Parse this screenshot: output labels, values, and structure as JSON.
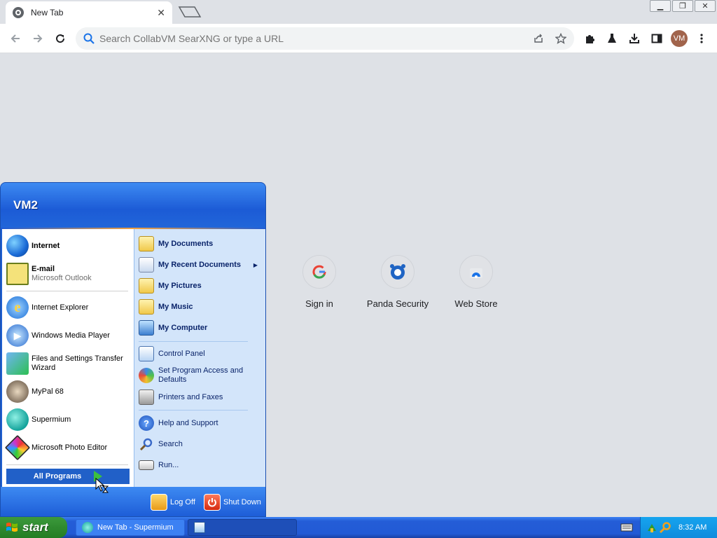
{
  "browser": {
    "tab_title": "New Tab",
    "tab_close": "✕",
    "window_controls": [
      "▁",
      "❐",
      "✕"
    ],
    "omnibox_placeholder": "Search CollabVM SearXNG or type a URL",
    "profile_initials": "VM"
  },
  "shortcuts": [
    {
      "label": "Sign in"
    },
    {
      "label": "Panda Security"
    },
    {
      "label": "Web Store"
    }
  ],
  "start_menu": {
    "user_name": "VM2",
    "pinned": [
      {
        "title": "Internet"
      },
      {
        "title": "E-mail",
        "subtitle": "Microsoft Outlook"
      }
    ],
    "recent": [
      {
        "title": "Internet Explorer"
      },
      {
        "title": "Windows Media Player"
      },
      {
        "title": "Files and Settings Transfer Wizard"
      },
      {
        "title": "MyPal 68"
      },
      {
        "title": "Supermium"
      },
      {
        "title": "Microsoft Photo Editor"
      }
    ],
    "all_programs": "All Programs",
    "places": [
      {
        "title": "My Documents"
      },
      {
        "title": "My Recent Documents"
      },
      {
        "title": "My Pictures"
      },
      {
        "title": "My Music"
      },
      {
        "title": "My Computer"
      }
    ],
    "settings": [
      {
        "title": "Control Panel"
      },
      {
        "title": "Set Program Access and Defaults"
      },
      {
        "title": "Printers and Faxes"
      }
    ],
    "help": [
      {
        "title": "Help and Support"
      },
      {
        "title": "Search"
      },
      {
        "title": "Run..."
      }
    ],
    "log_off": "Log Off",
    "shut_down": "Shut Down"
  },
  "taskbar": {
    "start_label": "start",
    "tasks": [
      {
        "label": "New Tab - Supermium"
      },
      {
        "label": ""
      }
    ],
    "clock": "8:32 AM"
  }
}
